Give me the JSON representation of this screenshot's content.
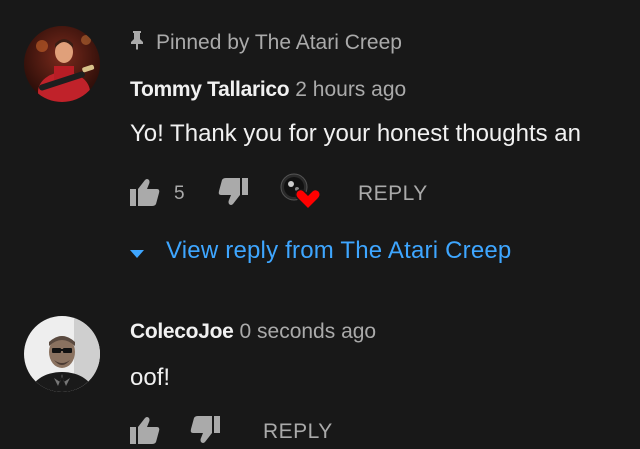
{
  "comments": [
    {
      "pinned_label": "Pinned by The Atari Creep",
      "author": "Tommy Tallarico",
      "time": "2 hours ago",
      "text": "Yo!  Thank you for your honest thoughts an",
      "like_count": "5",
      "reply_label": "REPLY",
      "view_reply_label": "View reply from The Atari Creep"
    },
    {
      "author": "ColecoJoe",
      "time": "0 seconds ago",
      "text": "oof!",
      "reply_label": "REPLY"
    }
  ],
  "colors": {
    "background": "#181818",
    "primary_text": "#f1f1f1",
    "secondary_text": "#aaaaaa",
    "link_blue": "#3ea6ff",
    "heart_red": "#ff0000"
  },
  "icons": [
    "pin-icon",
    "thumbs-up-icon",
    "thumbs-down-icon",
    "creator-heart-icon",
    "chevron-down-icon"
  ]
}
